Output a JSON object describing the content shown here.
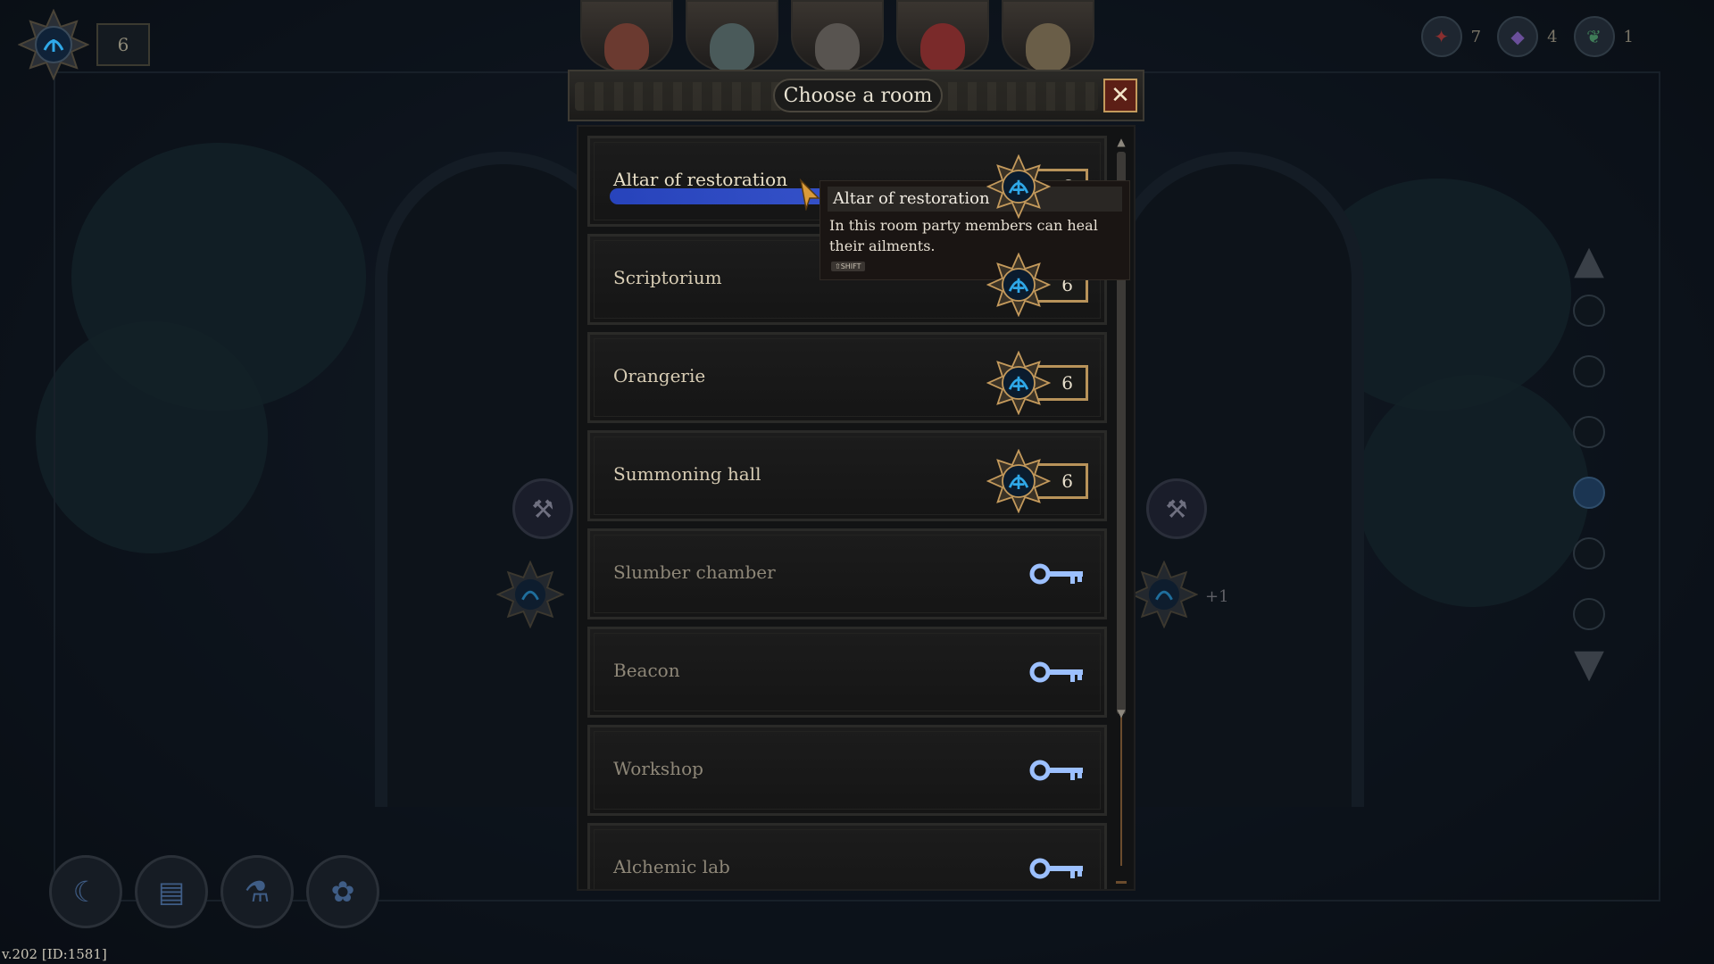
{
  "hud": {
    "top_left_count": "6",
    "resources": [
      {
        "icon": "red-rune-icon",
        "value": "7",
        "color": "#b03a3a"
      },
      {
        "icon": "purple-crystal-icon",
        "value": "4",
        "color": "#7b5bb3"
      },
      {
        "icon": "green-leaf-icon",
        "value": "1",
        "color": "#4c9a6a"
      }
    ],
    "side_plus_label": "+1"
  },
  "dialog": {
    "title": "Choose a room",
    "close_glyph": "✕",
    "rooms": [
      {
        "name": "Altar of restoration",
        "cost": "6",
        "locked": false,
        "selected": true
      },
      {
        "name": "Scriptorium",
        "cost": "6",
        "locked": false,
        "selected": false
      },
      {
        "name": "Orangerie",
        "cost": "6",
        "locked": false,
        "selected": false
      },
      {
        "name": "Summoning hall",
        "cost": "6",
        "locked": false,
        "selected": false
      },
      {
        "name": "Slumber chamber",
        "cost": "",
        "locked": true,
        "selected": false
      },
      {
        "name": "Beacon",
        "cost": "",
        "locked": true,
        "selected": false
      },
      {
        "name": "Workshop",
        "cost": "",
        "locked": true,
        "selected": false
      },
      {
        "name": "Alchemic lab",
        "cost": "",
        "locked": true,
        "selected": false
      }
    ]
  },
  "tooltip": {
    "title": "Altar of restoration",
    "description": "In this room party members can heal their ailments.",
    "key_hint": "⇧SHIFT"
  },
  "footer": {
    "version": "v.202 [ID:1581]"
  },
  "colors": {
    "accent_blue": "#2fa8e8",
    "gold": "#b8935a",
    "key_blue": "#9cc0ff"
  }
}
